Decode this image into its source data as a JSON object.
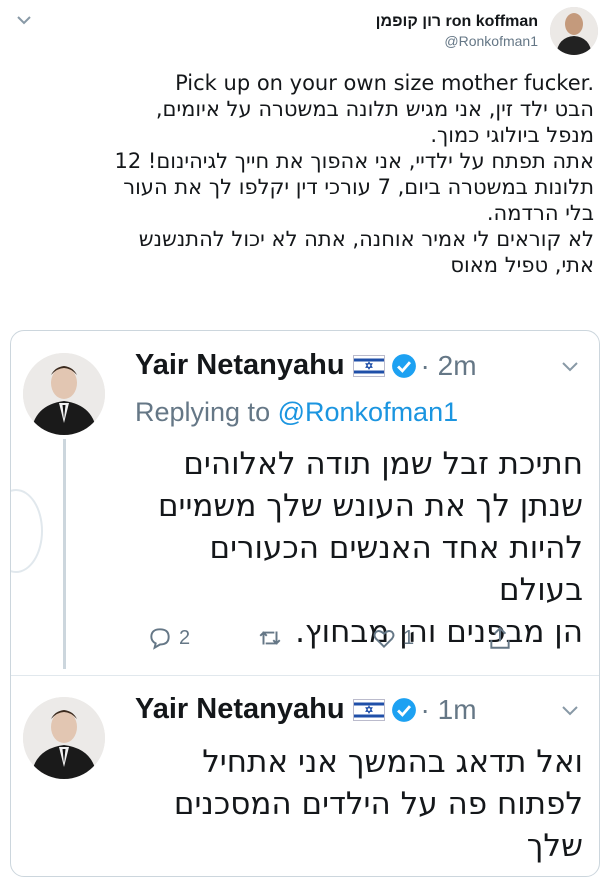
{
  "author": {
    "display_name": "רון קופמן ron koffman",
    "handle": "@Ronkofman1"
  },
  "tweet_text": [
    "Pick up on your own size mother fucker.",
    "הבט ילד זין, אני מגיש תלונה במשטרה על איומים,",
    "מנפל ביולוגי כמוך.",
    "אתה תפתח על ילדיי, אני אהפוך את חייך לגיהינום! 12",
    "תלונות במשטרה ביום, 7 עורכי דין יקלפו לך את העור",
    "בלי הרדמה.",
    "לא קוראים לי אמיר אוחנה, אתה לא יכול להתנשנש",
    "אתי, טפיל מאוס"
  ],
  "replies": [
    {
      "name": "Yair Netanyahu",
      "time": "2m",
      "replying_prefix": "Replying to",
      "replying_to": "@Ronkofman1",
      "body": [
        "חתיכת זבל שמן תודה לאלוהים",
        "שנתן לך את העונש שלך משמיים",
        "להיות אחד האנשים הכעורים בעולם",
        "הן מבפנים והן מבחוץ."
      ],
      "reply_count": "2",
      "retweet_count": "",
      "like_count": "1"
    },
    {
      "name": "Yair Netanyahu",
      "time": "1m",
      "body": [
        "ואל תדאג בהמשך אני אתחיל",
        "לפתוח פה על הילדים המסכנים",
        "שלך"
      ]
    }
  ],
  "icons": [
    "chevron-down-icon",
    "israel-flag-icon",
    "verified-badge-icon",
    "reply-icon",
    "retweet-icon",
    "like-icon",
    "share-icon"
  ],
  "colors": {
    "link": "#1b95e0",
    "muted": "#657786",
    "verified": "#1da1f2",
    "border": "#ccd6dd"
  }
}
